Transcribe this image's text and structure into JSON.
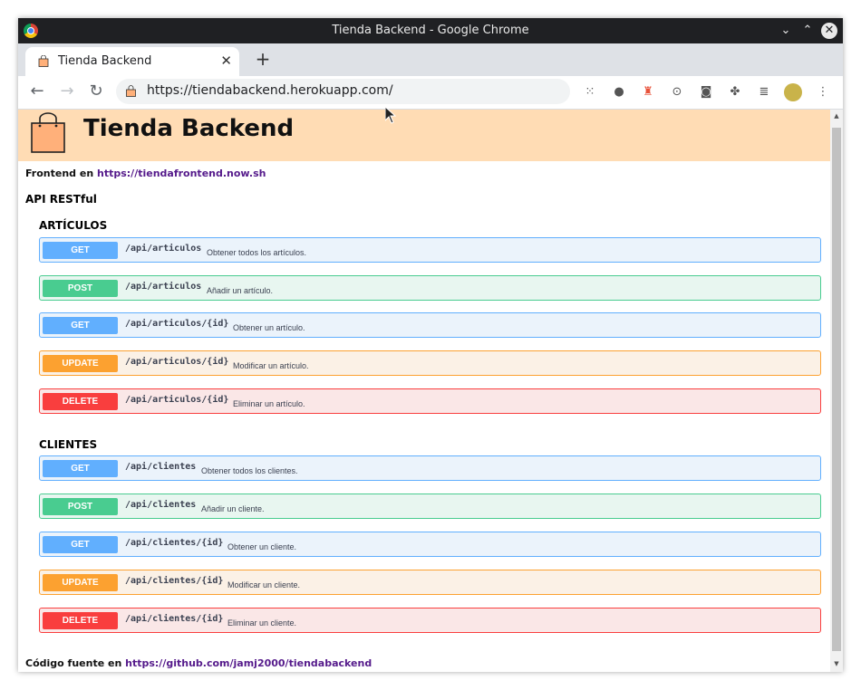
{
  "window": {
    "title": "Tienda Backend - Google Chrome"
  },
  "tab": {
    "title": "Tienda Backend",
    "close": "✕"
  },
  "newtab": "+",
  "toolbar": {
    "url": "https://tiendabackend.herokuapp.com/"
  },
  "header": {
    "title": "Tienda Backend"
  },
  "frontend": {
    "label": "Frontend en",
    "link": "https://tiendafrontend.now.sh"
  },
  "api_title": "API RESTful",
  "sections": [
    {
      "title": "ARTÍCULOS",
      "endpoints": [
        {
          "method": "GET",
          "path": "/api/articulos",
          "desc": "Obtener todos los artículos."
        },
        {
          "method": "POST",
          "path": "/api/articulos",
          "desc": "Añadir un artículo."
        },
        {
          "method": "GET",
          "path": "/api/articulos/{id}",
          "desc": "Obtener un artículo."
        },
        {
          "method": "UPDATE",
          "path": "/api/articulos/{id}",
          "desc": "Modificar un artículo."
        },
        {
          "method": "DELETE",
          "path": "/api/articulos/{id}",
          "desc": "Eliminar un artículo."
        }
      ]
    },
    {
      "title": "CLIENTES",
      "endpoints": [
        {
          "method": "GET",
          "path": "/api/clientes",
          "desc": "Obtener todos los clientes."
        },
        {
          "method": "POST",
          "path": "/api/clientes",
          "desc": "Añadir un cliente."
        },
        {
          "method": "GET",
          "path": "/api/clientes/{id}",
          "desc": "Obtener un cliente."
        },
        {
          "method": "UPDATE",
          "path": "/api/clientes/{id}",
          "desc": "Modificar un cliente."
        },
        {
          "method": "DELETE",
          "path": "/api/clientes/{id}",
          "desc": "Eliminar un cliente."
        }
      ]
    }
  ],
  "source": {
    "label": "Código fuente en",
    "link": "https://github.com/jamj2000/tiendabackend"
  },
  "colors": {
    "get": "#61affe",
    "post": "#49cc90",
    "update": "#fca130",
    "delete": "#f93e3e",
    "header_bg": "#ffdcb4"
  }
}
